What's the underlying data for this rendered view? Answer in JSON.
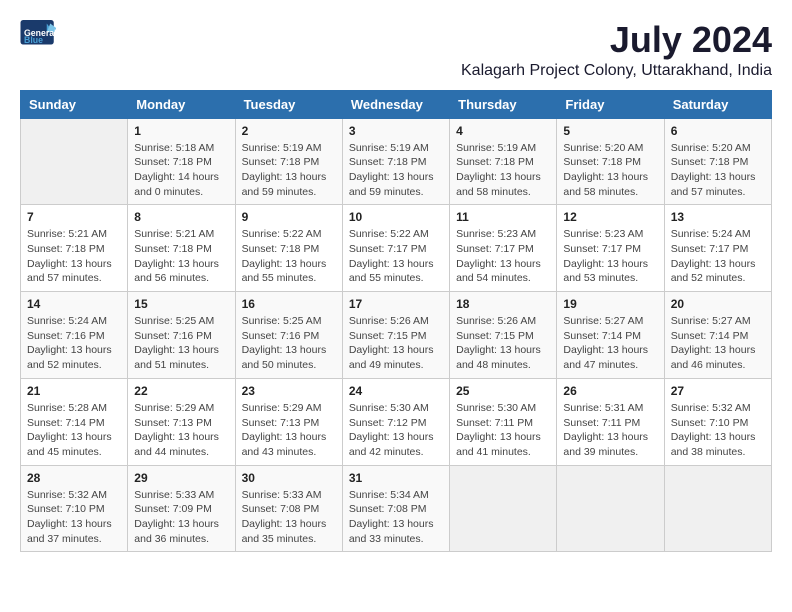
{
  "logo": {
    "text_general": "General",
    "text_blue": "Blue"
  },
  "title": "July 2024",
  "location": "Kalagarh Project Colony, Uttarakhand, India",
  "weekdays": [
    "Sunday",
    "Monday",
    "Tuesday",
    "Wednesday",
    "Thursday",
    "Friday",
    "Saturday"
  ],
  "weeks": [
    [
      {
        "day": "",
        "sunrise": "",
        "sunset": "",
        "daylight": ""
      },
      {
        "day": "1",
        "sunrise": "Sunrise: 5:18 AM",
        "sunset": "Sunset: 7:18 PM",
        "daylight": "Daylight: 14 hours and 0 minutes."
      },
      {
        "day": "2",
        "sunrise": "Sunrise: 5:19 AM",
        "sunset": "Sunset: 7:18 PM",
        "daylight": "Daylight: 13 hours and 59 minutes."
      },
      {
        "day": "3",
        "sunrise": "Sunrise: 5:19 AM",
        "sunset": "Sunset: 7:18 PM",
        "daylight": "Daylight: 13 hours and 59 minutes."
      },
      {
        "day": "4",
        "sunrise": "Sunrise: 5:19 AM",
        "sunset": "Sunset: 7:18 PM",
        "daylight": "Daylight: 13 hours and 58 minutes."
      },
      {
        "day": "5",
        "sunrise": "Sunrise: 5:20 AM",
        "sunset": "Sunset: 7:18 PM",
        "daylight": "Daylight: 13 hours and 58 minutes."
      },
      {
        "day": "6",
        "sunrise": "Sunrise: 5:20 AM",
        "sunset": "Sunset: 7:18 PM",
        "daylight": "Daylight: 13 hours and 57 minutes."
      }
    ],
    [
      {
        "day": "7",
        "sunrise": "Sunrise: 5:21 AM",
        "sunset": "Sunset: 7:18 PM",
        "daylight": "Daylight: 13 hours and 57 minutes."
      },
      {
        "day": "8",
        "sunrise": "Sunrise: 5:21 AM",
        "sunset": "Sunset: 7:18 PM",
        "daylight": "Daylight: 13 hours and 56 minutes."
      },
      {
        "day": "9",
        "sunrise": "Sunrise: 5:22 AM",
        "sunset": "Sunset: 7:18 PM",
        "daylight": "Daylight: 13 hours and 55 minutes."
      },
      {
        "day": "10",
        "sunrise": "Sunrise: 5:22 AM",
        "sunset": "Sunset: 7:17 PM",
        "daylight": "Daylight: 13 hours and 55 minutes."
      },
      {
        "day": "11",
        "sunrise": "Sunrise: 5:23 AM",
        "sunset": "Sunset: 7:17 PM",
        "daylight": "Daylight: 13 hours and 54 minutes."
      },
      {
        "day": "12",
        "sunrise": "Sunrise: 5:23 AM",
        "sunset": "Sunset: 7:17 PM",
        "daylight": "Daylight: 13 hours and 53 minutes."
      },
      {
        "day": "13",
        "sunrise": "Sunrise: 5:24 AM",
        "sunset": "Sunset: 7:17 PM",
        "daylight": "Daylight: 13 hours and 52 minutes."
      }
    ],
    [
      {
        "day": "14",
        "sunrise": "Sunrise: 5:24 AM",
        "sunset": "Sunset: 7:16 PM",
        "daylight": "Daylight: 13 hours and 52 minutes."
      },
      {
        "day": "15",
        "sunrise": "Sunrise: 5:25 AM",
        "sunset": "Sunset: 7:16 PM",
        "daylight": "Daylight: 13 hours and 51 minutes."
      },
      {
        "day": "16",
        "sunrise": "Sunrise: 5:25 AM",
        "sunset": "Sunset: 7:16 PM",
        "daylight": "Daylight: 13 hours and 50 minutes."
      },
      {
        "day": "17",
        "sunrise": "Sunrise: 5:26 AM",
        "sunset": "Sunset: 7:15 PM",
        "daylight": "Daylight: 13 hours and 49 minutes."
      },
      {
        "day": "18",
        "sunrise": "Sunrise: 5:26 AM",
        "sunset": "Sunset: 7:15 PM",
        "daylight": "Daylight: 13 hours and 48 minutes."
      },
      {
        "day": "19",
        "sunrise": "Sunrise: 5:27 AM",
        "sunset": "Sunset: 7:14 PM",
        "daylight": "Daylight: 13 hours and 47 minutes."
      },
      {
        "day": "20",
        "sunrise": "Sunrise: 5:27 AM",
        "sunset": "Sunset: 7:14 PM",
        "daylight": "Daylight: 13 hours and 46 minutes."
      }
    ],
    [
      {
        "day": "21",
        "sunrise": "Sunrise: 5:28 AM",
        "sunset": "Sunset: 7:14 PM",
        "daylight": "Daylight: 13 hours and 45 minutes."
      },
      {
        "day": "22",
        "sunrise": "Sunrise: 5:29 AM",
        "sunset": "Sunset: 7:13 PM",
        "daylight": "Daylight: 13 hours and 44 minutes."
      },
      {
        "day": "23",
        "sunrise": "Sunrise: 5:29 AM",
        "sunset": "Sunset: 7:13 PM",
        "daylight": "Daylight: 13 hours and 43 minutes."
      },
      {
        "day": "24",
        "sunrise": "Sunrise: 5:30 AM",
        "sunset": "Sunset: 7:12 PM",
        "daylight": "Daylight: 13 hours and 42 minutes."
      },
      {
        "day": "25",
        "sunrise": "Sunrise: 5:30 AM",
        "sunset": "Sunset: 7:11 PM",
        "daylight": "Daylight: 13 hours and 41 minutes."
      },
      {
        "day": "26",
        "sunrise": "Sunrise: 5:31 AM",
        "sunset": "Sunset: 7:11 PM",
        "daylight": "Daylight: 13 hours and 39 minutes."
      },
      {
        "day": "27",
        "sunrise": "Sunrise: 5:32 AM",
        "sunset": "Sunset: 7:10 PM",
        "daylight": "Daylight: 13 hours and 38 minutes."
      }
    ],
    [
      {
        "day": "28",
        "sunrise": "Sunrise: 5:32 AM",
        "sunset": "Sunset: 7:10 PM",
        "daylight": "Daylight: 13 hours and 37 minutes."
      },
      {
        "day": "29",
        "sunrise": "Sunrise: 5:33 AM",
        "sunset": "Sunset: 7:09 PM",
        "daylight": "Daylight: 13 hours and 36 minutes."
      },
      {
        "day": "30",
        "sunrise": "Sunrise: 5:33 AM",
        "sunset": "Sunset: 7:08 PM",
        "daylight": "Daylight: 13 hours and 35 minutes."
      },
      {
        "day": "31",
        "sunrise": "Sunrise: 5:34 AM",
        "sunset": "Sunset: 7:08 PM",
        "daylight": "Daylight: 13 hours and 33 minutes."
      },
      {
        "day": "",
        "sunrise": "",
        "sunset": "",
        "daylight": ""
      },
      {
        "day": "",
        "sunrise": "",
        "sunset": "",
        "daylight": ""
      },
      {
        "day": "",
        "sunrise": "",
        "sunset": "",
        "daylight": ""
      }
    ]
  ]
}
